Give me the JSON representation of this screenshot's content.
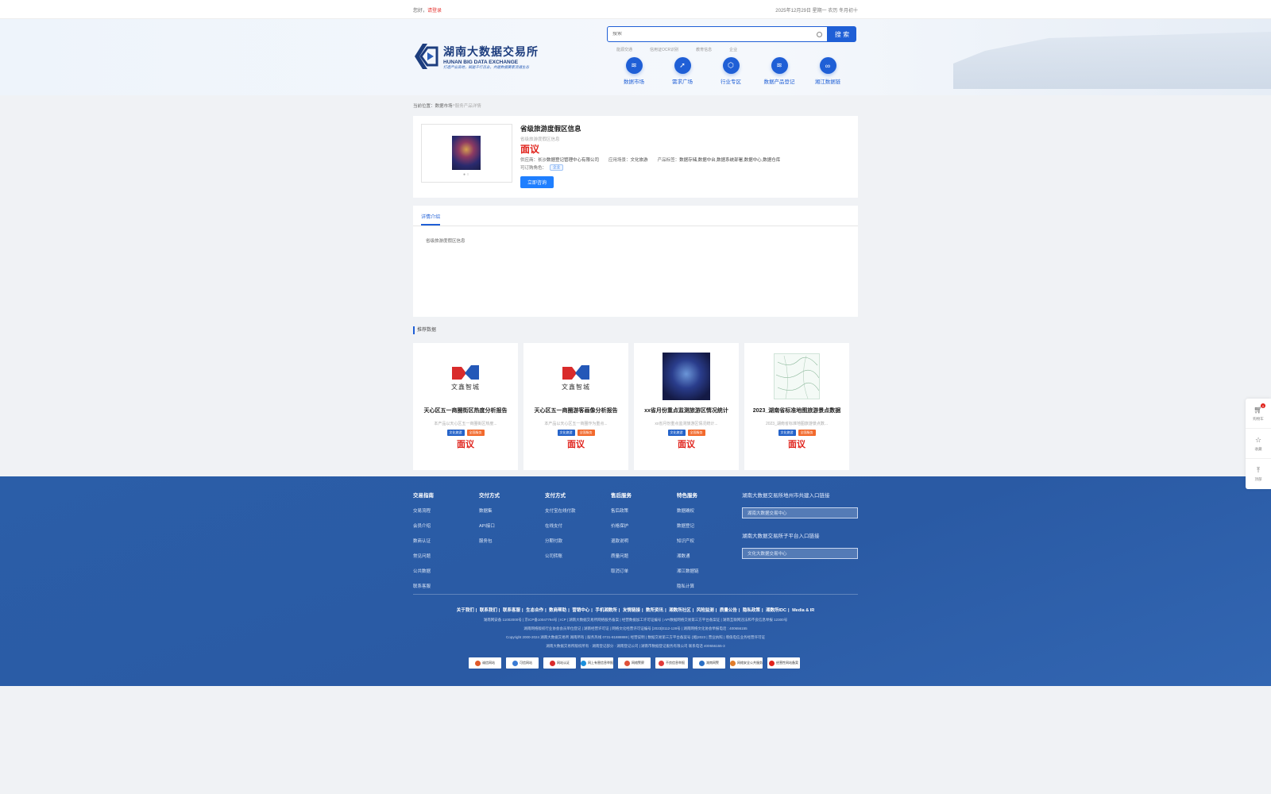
{
  "topbar": {
    "greeting": "您好，",
    "login_link": "请登录",
    "date": "2025年12月29日 星期一 农历 冬月初十"
  },
  "header": {
    "logo_cn": "湖南大数据交易所",
    "logo_en": "HUNAN BIG DATA EXCHANGE",
    "logo_slogan": "打造产业高地，赋能千行百业，共建数据要素流通生态",
    "search_placeholder": "搜索",
    "search_button": "搜 索",
    "hotwords": [
      "能源交通",
      "信用证OCR识别",
      "教育信息",
      "企业"
    ],
    "nav": [
      {
        "label": "数据市场",
        "icon": "database-icon",
        "glyph": "≋"
      },
      {
        "label": "需求广场",
        "icon": "compass-icon",
        "glyph": "➚"
      },
      {
        "label": "行业专区",
        "icon": "cube-icon",
        "glyph": "⬡"
      },
      {
        "label": "数据产品登记",
        "icon": "register-icon",
        "glyph": "≋"
      },
      {
        "label": "湘江数据链",
        "icon": "chain-icon",
        "glyph": "∞"
      }
    ]
  },
  "breadcrumb": {
    "prefix": "当前位置：",
    "level1": "数据市场",
    "sep": " > ",
    "current": "服务产品详情"
  },
  "product": {
    "title": "省级旅游度假区信息",
    "subtitle": "省级旅游度假区信息",
    "price": "面议",
    "supplier_label": "供应商：",
    "supplier": "长沙数据登记管理中心有限公司",
    "scene_label": "应用场景：",
    "scene": "文化旅游",
    "tags_label": "产品标签：",
    "tags": "数据存储,数据中台,数据系统部署,数据中心,数据仓库",
    "role_label": "可订购角色：",
    "role": "企业",
    "consult_button": "立即咨询",
    "thumb_dots": "● ○"
  },
  "detail": {
    "tab": "详情介绍",
    "body": "省级旅游度假区信息"
  },
  "recommend": {
    "heading": "推荐数据",
    "items": [
      {
        "title": "天心区五一商圈街区热度分析报告",
        "desc": "本产品以天心区五一商圈街区热度...",
        "tag1": "文化旅游",
        "tag2": "全国服务",
        "price": "面议",
        "brand": "文鑫智城"
      },
      {
        "title": "天心区五一商圈游客画像分析报告",
        "desc": "本产品以天心区五一商圈作为重点...",
        "tag1": "文化旅游",
        "tag2": "全国服务",
        "price": "面议",
        "brand": "文鑫智城"
      },
      {
        "title": "xx省月份重点监测旅游区情况统计",
        "desc": "xx省月份重点监测旅游区情况统计...",
        "tag1": "文化旅游",
        "tag2": "全国服务",
        "price": "面议"
      },
      {
        "title": "2023_湖南省标准地图旅游景点数据",
        "desc": "2023_湖南省标准地图旅游景点数...",
        "tag1": "文化旅游",
        "tag2": "全国服务",
        "price": "面议"
      }
    ]
  },
  "footer": {
    "cols": [
      {
        "head": "交易指南",
        "items": [
          "交易流程",
          "会员介绍",
          "数商认证",
          "常见问题",
          "公共数据",
          "联系客服"
        ]
      },
      {
        "head": "交付方式",
        "items": [
          "数据集",
          "API接口",
          "服务包"
        ]
      },
      {
        "head": "支付方式",
        "items": [
          "支付宝在线付款",
          "在线支付",
          "分期付款",
          "公司转账"
        ]
      },
      {
        "head": "售后服务",
        "items": [
          "售后政策",
          "价格保护",
          "退款说明",
          "质量问题",
          "取消订单"
        ]
      },
      {
        "head": "特色服务",
        "items": [
          "数据确权",
          "数据登记",
          "知识产权",
          "湘数通",
          "湘江数据链",
          "隐私计算"
        ]
      }
    ],
    "link_head1": "湖南大数据交易所地州市共建入口链接",
    "link_sel1": "湖南大数据交易中心",
    "link_head2": "湖南大数据交易所子平台入口链接",
    "link_sel2": "文化大数据交易中心",
    "nav": [
      "关于我们",
      "联系我们",
      "联系客服",
      "生态合作",
      "数商帮助",
      "营销中心",
      "手机湘数所",
      "友情链接",
      "数所资讯",
      "湘数所社区",
      "风险监测",
      "质量公告",
      "隐私政策",
      "湘数所IDC",
      "Media & IR"
    ],
    "line1": "湖南网安备 11002000号 | 京ICP备10047794号 | ICP | 湖南大数据交易所网络服务备案 | 经营数据加工许可证编号 | API数据网络交易第三方平台备案证 | 湖南互联网违法和不良信息举报 12300号",
    "line2": "湖南网络版权行业协会会员单位登记 | 湖南经营许可证 | 网络文化经营许可证编号 [2023]0112-128号 | 湖南网络文化协会举报电话 : 400656155",
    "line3": "Copyright 2000-2024 湖南大数据交易所 湖南所有 | 服务热线 0731-81888888 | 经营说明 | 数据交易第三方平台备案号 (湘)2023 | 营业执照 | 增值电信业务经营许可证",
    "line4": "湖南大数据交易所版权所有 · 湖南登记部分 · 湖南登记公司 | 湖南市数据登记服务有限公司 联系电话 400656155-3",
    "badges": [
      {
        "text": "诚信网站",
        "color": "#e05a2a"
      },
      {
        "text": "可信网站",
        "color": "#3a7bd5"
      },
      {
        "text": "网站认证",
        "color": "#d92b2b"
      },
      {
        "text": "网上有害信息举报",
        "color": "#1b8fdc"
      },
      {
        "text": "网络警察",
        "color": "#e0523a"
      },
      {
        "text": "不良信息举报",
        "color": "#e03a3a"
      },
      {
        "text": "湖南网警",
        "color": "#2a6fc4"
      },
      {
        "text": "网络安全公共服务",
        "color": "#e07c2a"
      },
      {
        "text": "经营性网站备案",
        "color": "#e0231c"
      }
    ]
  },
  "float": {
    "cart": "购物车",
    "cart_count": "0",
    "collect": "收藏",
    "top": "顶部"
  }
}
